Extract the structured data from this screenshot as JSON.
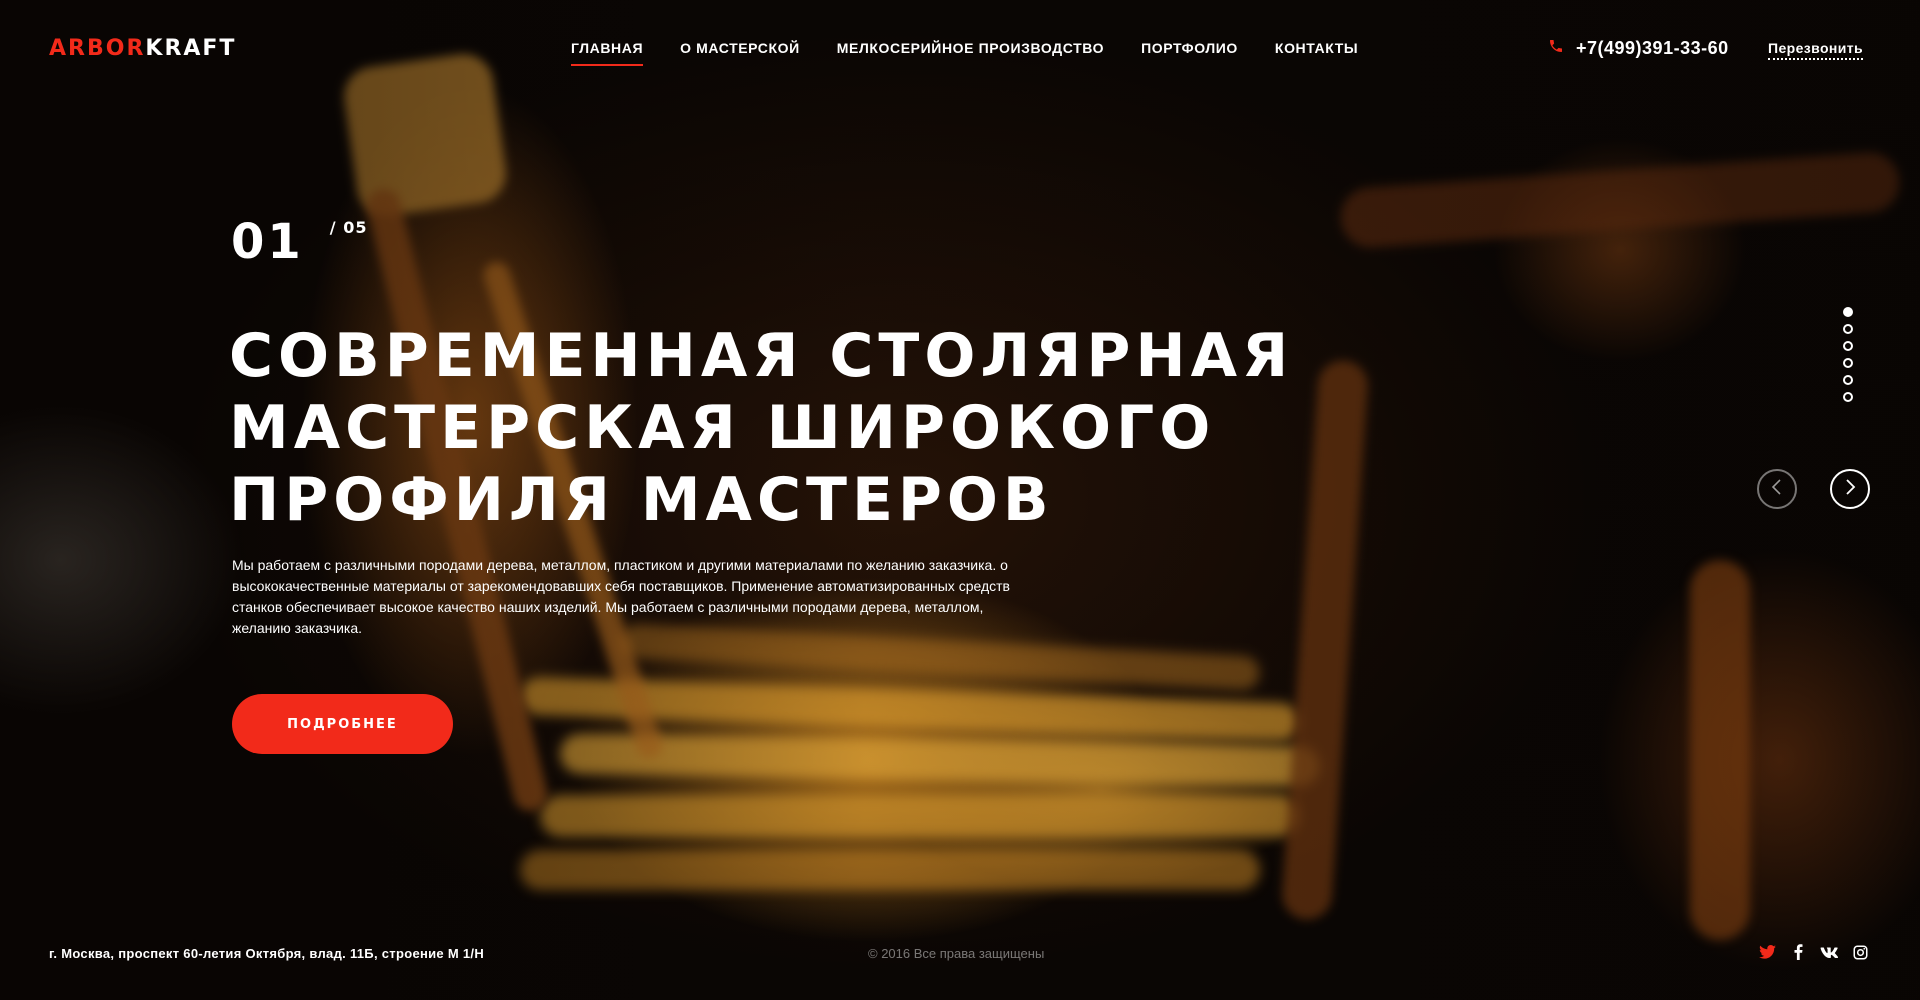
{
  "header": {
    "logo_part1": "ARBOR",
    "logo_part2": "KRAFT",
    "nav": [
      {
        "label": "ГЛАВНАЯ",
        "active": true
      },
      {
        "label": "О МАСТЕРСКОЙ"
      },
      {
        "label": "МЕЛКОСЕРИЙНОЕ ПРОИЗВОДСТВО"
      },
      {
        "label": "ПОРТФОЛИО"
      },
      {
        "label": "КОНТАКТЫ"
      }
    ],
    "phone_icon": "phone-icon",
    "phone": "+7(499)391-33-60",
    "callback_label": "Перезвонить"
  },
  "hero": {
    "slide_current": "01",
    "slide_total": "/ 05",
    "title_lines": [
      "СОВРЕМЕННАЯ СТОЛЯРНАЯ",
      "МАСТЕРСКАЯ ШИРОКОГО",
      "ПРОФИЛЯ МАСТЕРОВ"
    ],
    "description_lines": [
      "Мы работаем с различными породами дерева, металлом, пластиком и другими материалами по желанию заказчика. о",
      "высококачественные материалы от зарекомендовавших себя поставщиков. Применение автоматизированных средств",
      "станков обеспечивает высокое качество наших изделий. Мы работаем с различными породами дерева, металлом,",
      "желанию заказчика."
    ],
    "button_label": "ПОДРОБНЕЕ"
  },
  "slider": {
    "dots_count": 6,
    "active_dot": 1,
    "prev_icon": "chevron-left-icon",
    "next_icon": "chevron-right-icon"
  },
  "footer": {
    "address": "г. Москва, проспект 60-летия Октября, влад. 11Б, строение М 1/Н",
    "copyright": "© 2016 Все права защищены",
    "social": [
      "twitter-icon",
      "facebook-icon",
      "vk-icon",
      "instagram-icon"
    ]
  },
  "colors": {
    "accent": "#f22a1a",
    "text": "#ffffff"
  }
}
